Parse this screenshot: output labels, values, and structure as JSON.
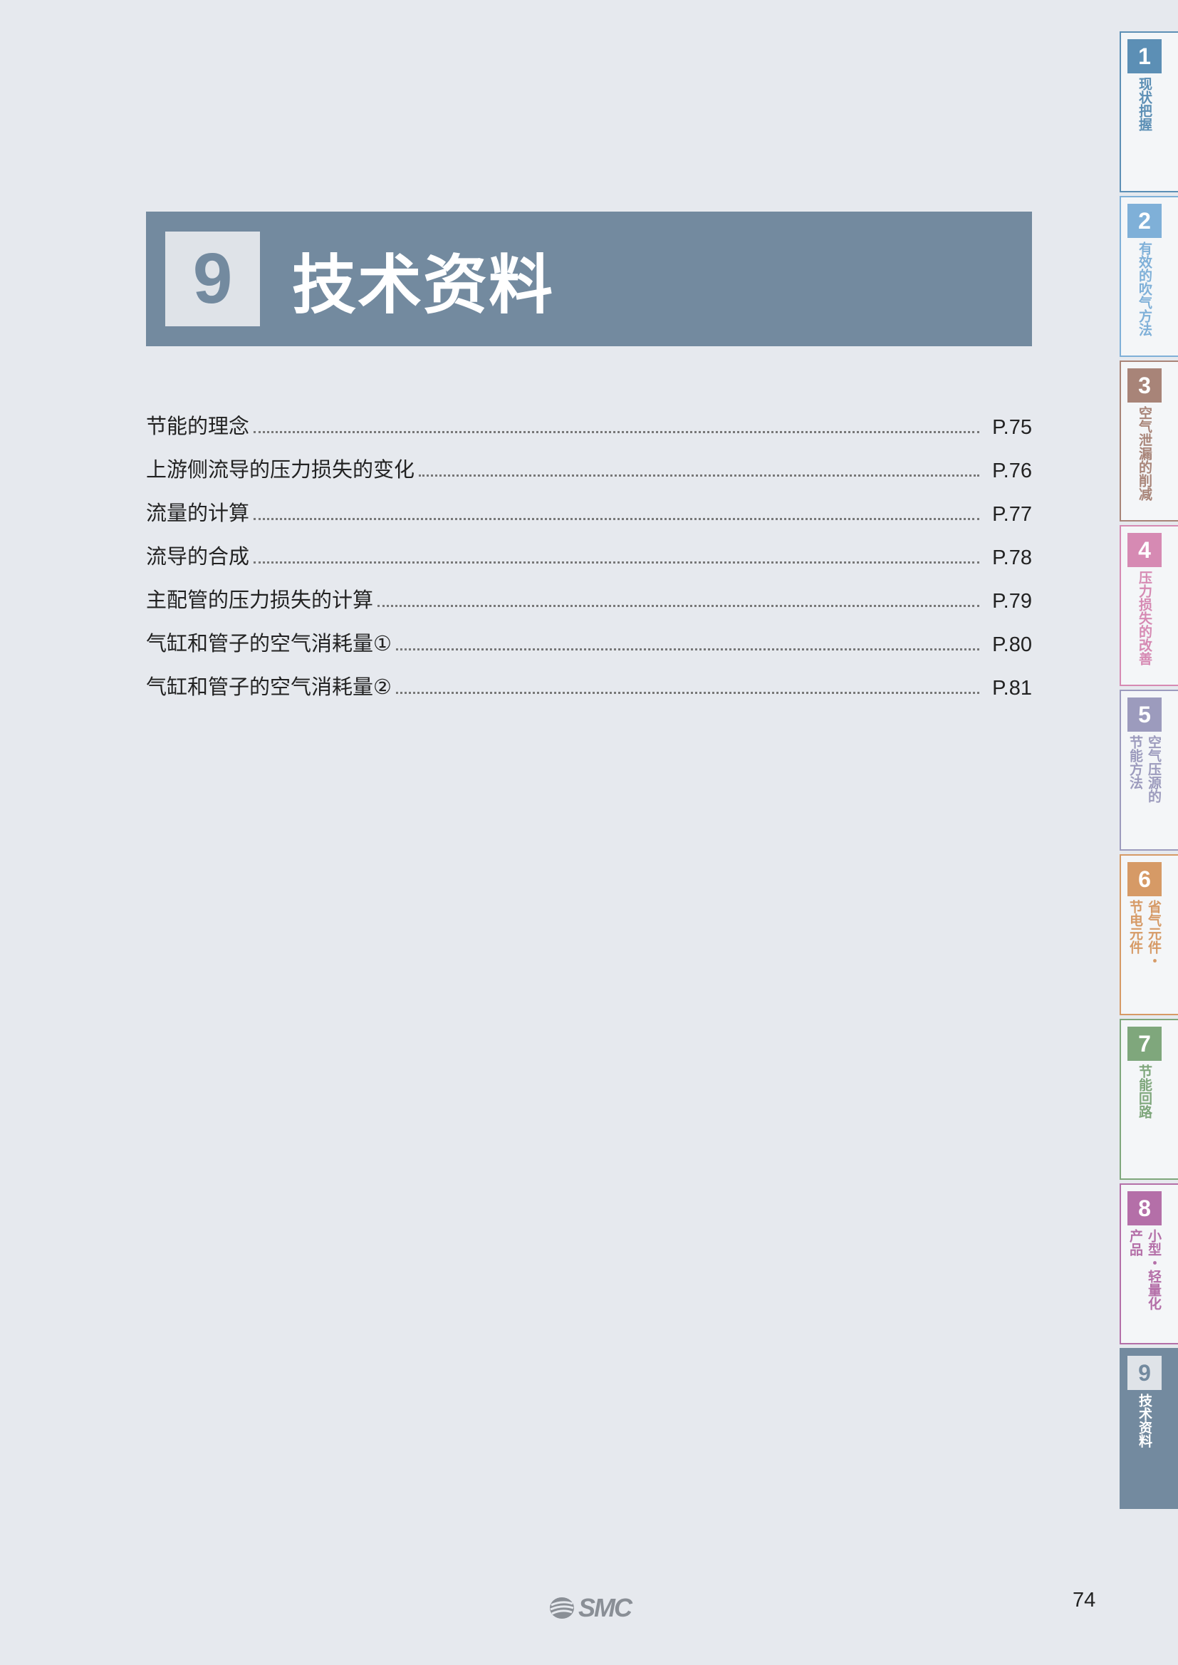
{
  "chapter": {
    "number": "9",
    "title": "技术资料"
  },
  "toc": [
    {
      "label": "节能的理念",
      "page": "P.75"
    },
    {
      "label": "上游侧流导的压力损失的变化",
      "page": "P.76"
    },
    {
      "label": "流量的计算",
      "page": "P.77"
    },
    {
      "label": "流导的合成",
      "page": "P.78"
    },
    {
      "label": "主配管的压力损失的计算",
      "page": "P.79"
    },
    {
      "label": "气缸和管子的空气消耗量①",
      "page": "P.80"
    },
    {
      "label": "气缸和管子的空气消耗量②",
      "page": "P.81"
    }
  ],
  "side_tabs": [
    {
      "number": "1",
      "columns": [
        "现状把握"
      ],
      "color": "#5c8fb5"
    },
    {
      "number": "2",
      "columns": [
        "有效的吹气方法"
      ],
      "color": "#7fb0d8"
    },
    {
      "number": "3",
      "columns": [
        "空气泄漏的削减"
      ],
      "color": "#a88478"
    },
    {
      "number": "4",
      "columns": [
        "压力损失的改善"
      ],
      "color": "#d68ab3"
    },
    {
      "number": "5",
      "columns": [
        "空气压源的",
        "节能方法"
      ],
      "color": "#9c9bbd"
    },
    {
      "number": "6",
      "columns": [
        "省气元件・",
        "节电元件"
      ],
      "color": "#d69a66"
    },
    {
      "number": "7",
      "columns": [
        "节能回路"
      ],
      "color": "#7fa77c"
    },
    {
      "number": "8",
      "columns": [
        "小型・轻量化",
        "产品"
      ],
      "color": "#b46fa8"
    },
    {
      "number": "9",
      "columns": [
        "技术资料"
      ],
      "color": "#738a9f"
    }
  ],
  "active_tab": "9",
  "footer": {
    "logo": "SMC",
    "page_number": "74"
  }
}
